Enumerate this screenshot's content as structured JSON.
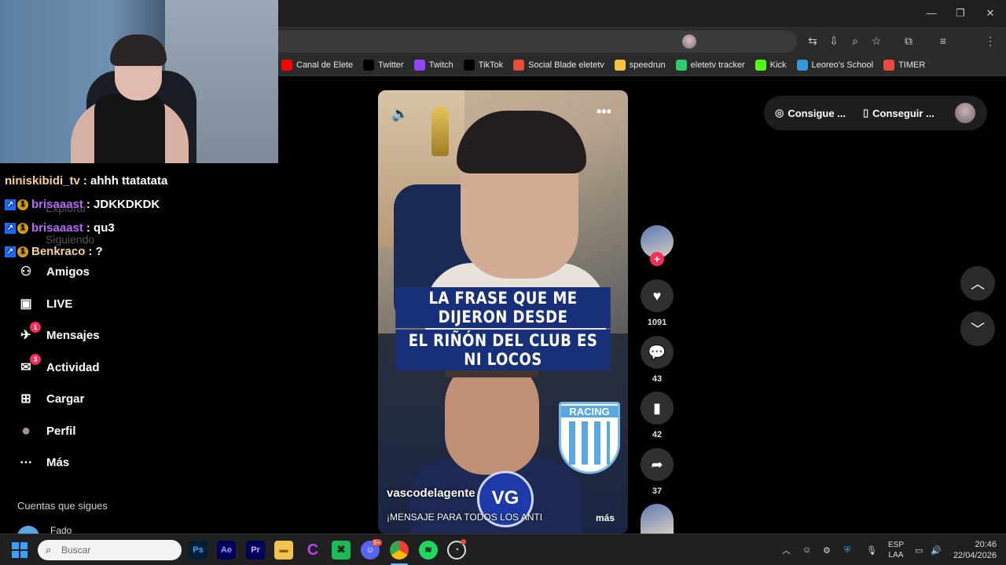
{
  "bookmarks": [
    {
      "label": "Canal de Elete",
      "color": "#ff0000",
      "icon": "youtube-icon"
    },
    {
      "label": "Twitter",
      "color": "#000000",
      "icon": "x-icon"
    },
    {
      "label": "Twitch",
      "color": "#9146ff",
      "icon": "twitch-icon"
    },
    {
      "label": "TikTok",
      "color": "#000000",
      "icon": "tiktok-icon"
    },
    {
      "label": "Social Blade eletetv",
      "color": "#e74c3c",
      "icon": "socialblade-icon"
    },
    {
      "label": "speedrun",
      "color": "#f5c542",
      "icon": "speedrun-icon"
    },
    {
      "label": "eletetv tracker",
      "color": "#2ecc71",
      "icon": "tracker-icon"
    },
    {
      "label": "Kick",
      "color": "#53fc18",
      "icon": "kick-icon"
    },
    {
      "label": "Leoreo's School",
      "color": "#3498db",
      "icon": "school-icon"
    },
    {
      "label": "TIMER",
      "color": "#e74c3c",
      "icon": "timer-icon"
    }
  ],
  "chat": [
    {
      "user": "niniskibidi_tv",
      "message": ": ahhh ttatatata",
      "color": "#f7d38f",
      "badges": false
    },
    {
      "user": "brisaaast",
      "message": ": JDKKDKDK",
      "color": "#b967ff",
      "badges": true
    },
    {
      "user": "brisaaast",
      "message": ": qu3",
      "color": "#b967ff",
      "badges": true
    },
    {
      "user": "Benkraco",
      "message": ": ?",
      "color": "#f7d38f",
      "badges": true
    }
  ],
  "ghost_nav": {
    "explore": "Explorar",
    "following": "Siguiendo"
  },
  "nav": [
    {
      "label": "Amigos",
      "icon": "friends-icon",
      "badge": ""
    },
    {
      "label": "LIVE",
      "icon": "live-icon",
      "badge": ""
    },
    {
      "label": "Mensajes",
      "icon": "messages-icon",
      "badge": "1"
    },
    {
      "label": "Actividad",
      "icon": "activity-icon",
      "badge": "3"
    },
    {
      "label": "Cargar",
      "icon": "upload-icon",
      "badge": ""
    },
    {
      "label": "Perfil",
      "icon": "profile-icon",
      "badge": ""
    },
    {
      "label": "Más",
      "icon": "more-icon",
      "badge": ""
    }
  ],
  "following_section": "Cuentas que sigues",
  "following_first": "Fado",
  "video": {
    "caption_line1": "LA FRASE QUE ME DIJERON DESDE",
    "caption_line2": "EL RIÑÓN DEL CLUB ES NI LOCOS",
    "racing_label": "RACING",
    "logo_text": "VG",
    "username": "vascodelagente",
    "description": "¡MENSAJE PARA TODOS LOS ANTI",
    "more": "más"
  },
  "actions": {
    "likes": "1091",
    "comments": "43",
    "saves": "42",
    "shares": "37"
  },
  "top_right": {
    "get_coins": "Consigue ...",
    "get_app": "Conseguir ..."
  },
  "taskbar": {
    "search_placeholder": "Buscar",
    "lang_top": "ESP",
    "lang_bottom": "LAA",
    "time": "20:46",
    "date": "22/04/2026",
    "discord_badge": "9+"
  },
  "colors": {
    "accent": "#fe2c55",
    "panel": "#2f2f2f"
  }
}
